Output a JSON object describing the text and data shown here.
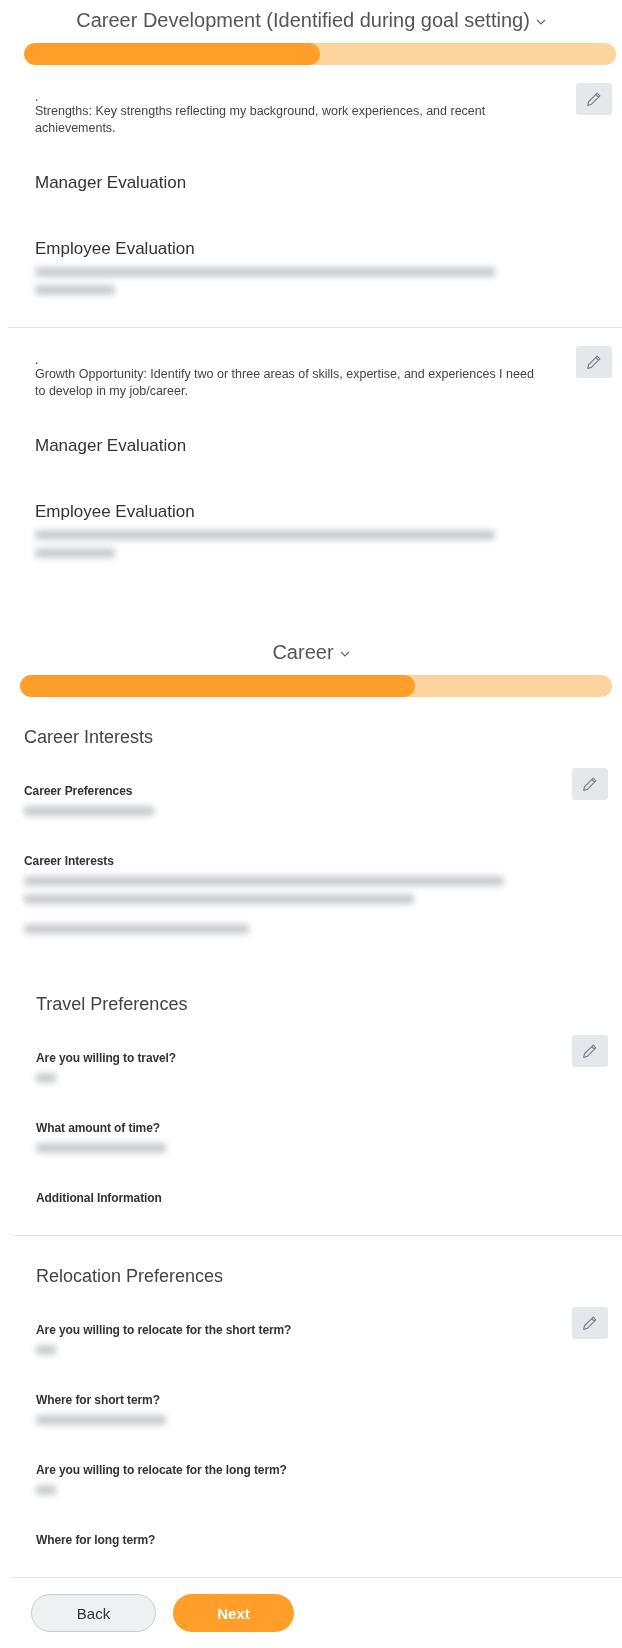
{
  "sections": [
    {
      "title": "Career Development (Identified during goal setting)",
      "progress": {
        "level": 0.5
      },
      "kind": "goals",
      "goals": [
        {
          "marker": ".",
          "text": "Strengths: Key strengths reflecting my background, work experiences, and recent achievements.",
          "labels": [
            "Manager Evaluation",
            "Employee Evaluation"
          ],
          "kind": "answered"
        },
        {
          "marker": ".",
          "text": "Growth Opportunity: Identify two or three areas of skills, expertise, and experiences I need to develop in my job/career.",
          "labels": [
            "Manager Evaluation",
            "Employee Evaluation"
          ],
          "kind": "answered"
        }
      ]
    },
    {
      "title": "Career",
      "progress": {
        "level": 0.667
      },
      "kind": "career",
      "groups": [
        {
          "heading": "Career Interests",
          "fields": [
            {
              "label": "Career Preferences",
              "kind": "short"
            },
            {
              "label": "Career Interests",
              "kind": "long"
            }
          ]
        },
        {
          "heading": "Travel Preferences",
          "fields": [
            {
              "label": "Are you willing to travel?",
              "kind": "tiny"
            },
            {
              "label": "What amount of time?",
              "kind": "short"
            },
            {
              "label": "Additional Information",
              "kind": "empty"
            }
          ]
        },
        {
          "heading": "Relocation Preferences",
          "fields": [
            {
              "label": "Are you willing to relocate for the short term?",
              "kind": "tiny"
            },
            {
              "label": "Where for short term?",
              "kind": "short"
            },
            {
              "label": "Are you willing to relocate for the long term?",
              "kind": "tiny"
            },
            {
              "label": "Where for long term?",
              "kind": "empty"
            }
          ]
        }
      ]
    }
  ],
  "buttons": [
    {
      "label": "Back",
      "kind": "secondary"
    },
    {
      "label": "Next",
      "kind": "primary"
    }
  ]
}
